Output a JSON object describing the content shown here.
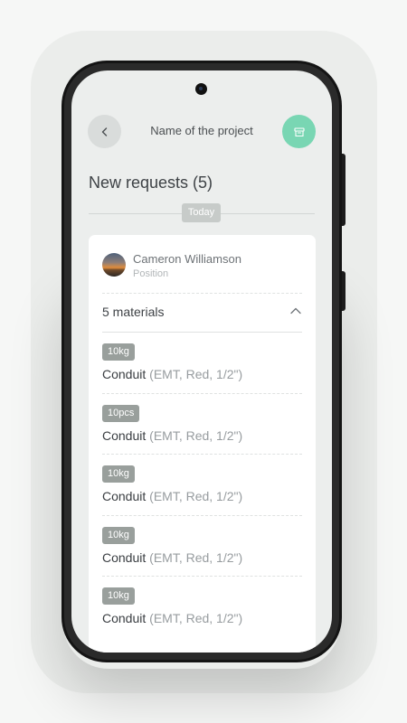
{
  "header": {
    "title": "Name of the project",
    "back_icon": "chevron-left-icon",
    "archive_icon": "archive-box-icon",
    "accent_color": "#79d6b3"
  },
  "requests": {
    "title": "New requests (5)",
    "date_label": "Today"
  },
  "request_card": {
    "person": {
      "name": "Cameron Williamson",
      "position": "Position"
    },
    "materials_label": "5 materials",
    "toggle_icon": "chevron-up-icon",
    "items": [
      {
        "qty": "10kg",
        "name": "Conduit",
        "spec": "(EMT, Red, 1/2\")"
      },
      {
        "qty": "10pcs",
        "name": "Conduit",
        "spec": "(EMT, Red, 1/2\")"
      },
      {
        "qty": "10kg",
        "name": "Conduit",
        "spec": "(EMT, Red, 1/2\")"
      },
      {
        "qty": "10kg",
        "name": "Conduit",
        "spec": "(EMT, Red, 1/2\")"
      },
      {
        "qty": "10kg",
        "name": "Conduit",
        "spec": "(EMT, Red, 1/2\")"
      }
    ]
  }
}
